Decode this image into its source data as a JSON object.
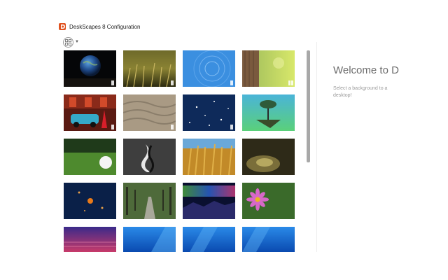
{
  "window": {
    "title": "DeskScapes 8 Configuration"
  },
  "toolbar": {
    "view_icon": "view-options-icon",
    "caret_icon": "chevron-down-icon"
  },
  "gallery": {
    "columns": 4,
    "items": [
      {
        "name": "earth-space",
        "badge": "single"
      },
      {
        "name": "golden-grass",
        "badge": "single"
      },
      {
        "name": "blue-swirl",
        "badge": "single"
      },
      {
        "name": "tree-trunk-bokeh",
        "badge": "double"
      },
      {
        "name": "red-car-street",
        "badge": "single"
      },
      {
        "name": "sand-ripples",
        "badge": "single"
      },
      {
        "name": "night-stars",
        "badge": "single"
      },
      {
        "name": "floating-island",
        "badge": "none"
      },
      {
        "name": "golf-ball",
        "badge": "none"
      },
      {
        "name": "black-white-wave",
        "badge": "none"
      },
      {
        "name": "wheat-field",
        "badge": "none"
      },
      {
        "name": "dry-grass-sunlight",
        "badge": "none"
      },
      {
        "name": "planets-blue",
        "badge": "none"
      },
      {
        "name": "tree-lined-road",
        "badge": "none"
      },
      {
        "name": "aurora-lake",
        "badge": "none"
      },
      {
        "name": "pink-daisy",
        "badge": "none"
      },
      {
        "name": "purple-streaks",
        "badge": "none"
      },
      {
        "name": "windows-blue-1",
        "badge": "none"
      },
      {
        "name": "windows-blue-2",
        "badge": "none"
      },
      {
        "name": "windows-blue-3",
        "badge": "none"
      }
    ]
  },
  "right_panel": {
    "heading": "Welcome to D",
    "subtext": "Select a background to a desktop!"
  }
}
